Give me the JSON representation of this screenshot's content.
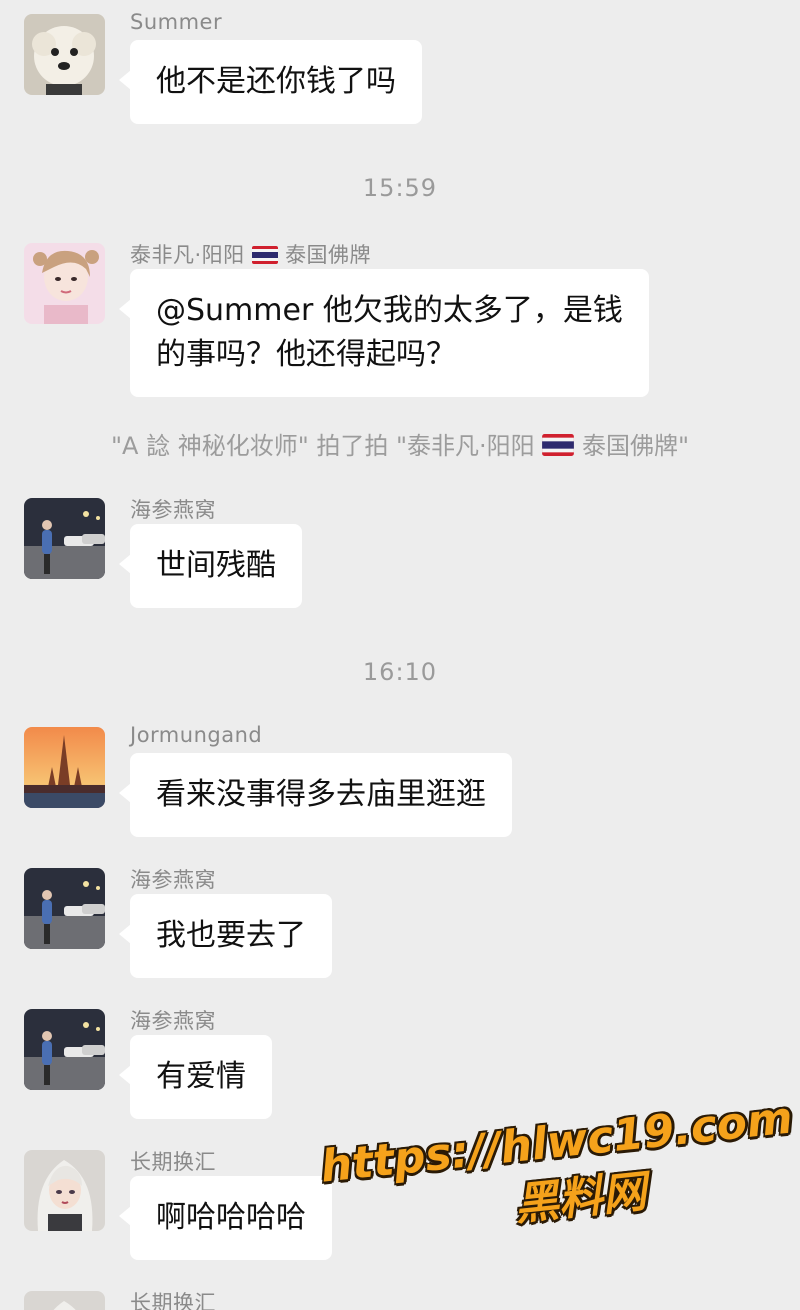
{
  "messages": [
    {
      "sender": "Summer",
      "text": "他不是还你钱了吗"
    },
    {
      "timestamp": "15:59"
    },
    {
      "sender": "泰非凡·阳阳",
      "sender_suffix": "泰国佛牌",
      "text_line1": "@Summer 他欠我的太多了，是钱",
      "text_line2": "的事吗？他还得起吗？"
    },
    {
      "system_part1": "\"A 諗 神秘化妆师\" 拍了拍 \"泰非凡·阳阳",
      "system_part2": "泰国佛牌\""
    },
    {
      "sender": "海参燕窝",
      "text": "世间残酷"
    },
    {
      "timestamp": "16:10"
    },
    {
      "sender": "Jormungand",
      "text": "看来没事得多去庙里逛逛"
    },
    {
      "sender": "海参燕窝",
      "text": "我也要去了"
    },
    {
      "sender": "海参燕窝",
      "text": "有爱情"
    },
    {
      "sender": "长期换汇",
      "text": "啊哈哈哈哈"
    },
    {
      "sender": "长期换汇"
    }
  ],
  "watermark": {
    "url": "https://hlwc19.com",
    "name": "黑料网"
  },
  "colors": {
    "background": "#ededed",
    "bubble": "#ffffff",
    "meta_text": "#8a8a8a",
    "watermark": "#f5a21b"
  }
}
